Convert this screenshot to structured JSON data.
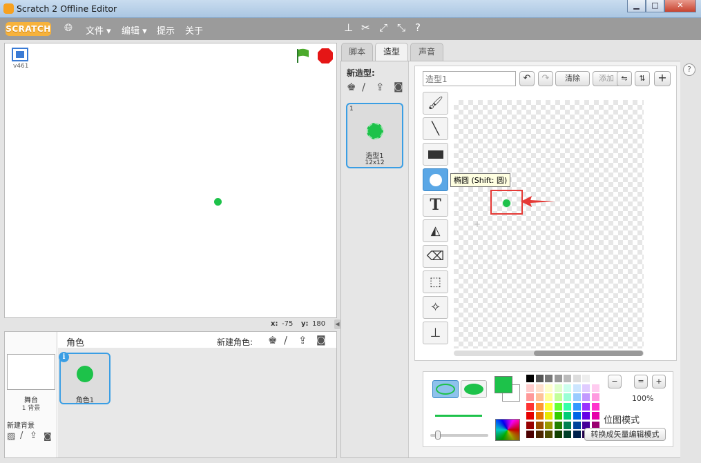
{
  "window": {
    "title": "Scratch 2 Offline Editor",
    "minimize": "▁",
    "maximize": "□",
    "close": "✕"
  },
  "menu": {
    "logo": "SCRATCH",
    "file": "文件 ▾",
    "edit": "编辑 ▾",
    "tips": "提示",
    "about": "关于"
  },
  "stage": {
    "version": "v461",
    "x_label": "x:",
    "x_value": "-75",
    "y_label": "y:",
    "y_value": "180"
  },
  "sprites": {
    "header": "角色",
    "new_sprite_label": "新建角色:",
    "stage_name": "舞台",
    "stage_backdrops": "1 背景",
    "new_backdrop_label": "新建背景",
    "items": [
      {
        "name": "角色1"
      }
    ]
  },
  "tabs": {
    "scripts": "脚本",
    "costumes": "造型",
    "sounds": "声音"
  },
  "costumes": {
    "new_costume_label": "新造型:",
    "items": [
      {
        "index": "1",
        "name": "造型1",
        "size": "12x12"
      }
    ]
  },
  "paint_editor": {
    "costume_name_value": "造型1",
    "clear_label": "清除",
    "add_label": "添加",
    "tooltip": "椭圆 (Shift: 圆)",
    "zoom_level": "100%",
    "bitmap_mode_label": "位图模式",
    "convert_label": "转换成矢量编辑模式",
    "fill_color": "#1dc24a",
    "outline_color": "#1dc24a"
  }
}
